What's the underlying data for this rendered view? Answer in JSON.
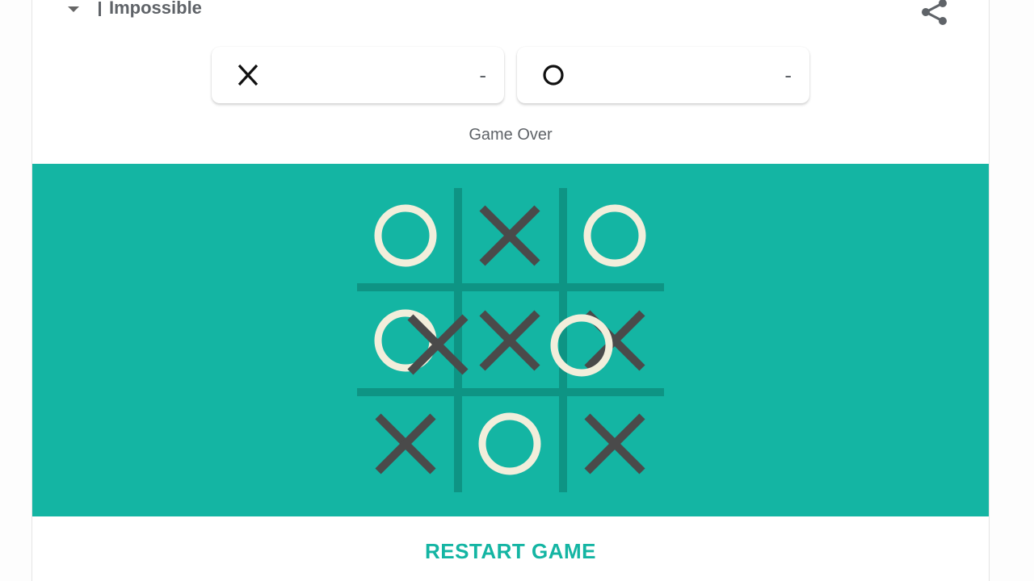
{
  "header": {
    "difficulty": "Impossible",
    "caret_icon": "caret-down-icon",
    "share_icon": "share-icon"
  },
  "scores": [
    {
      "player": "X",
      "value": "-"
    },
    {
      "player": "O",
      "value": "-"
    }
  ],
  "status": "Game Over",
  "board": {
    "colors": {
      "background": "#14b5a3",
      "grid": "#0e9484",
      "x_mark": "#4a4a4a",
      "o_mark": "#f2eedb"
    },
    "cells": [
      [
        "O",
        "X",
        "O"
      ],
      [
        "O",
        "X",
        "X"
      ],
      [
        "X",
        "O",
        "X"
      ]
    ],
    "overlay_marks": [
      "X",
      "O"
    ]
  },
  "restart_label": "RESTART GAME"
}
